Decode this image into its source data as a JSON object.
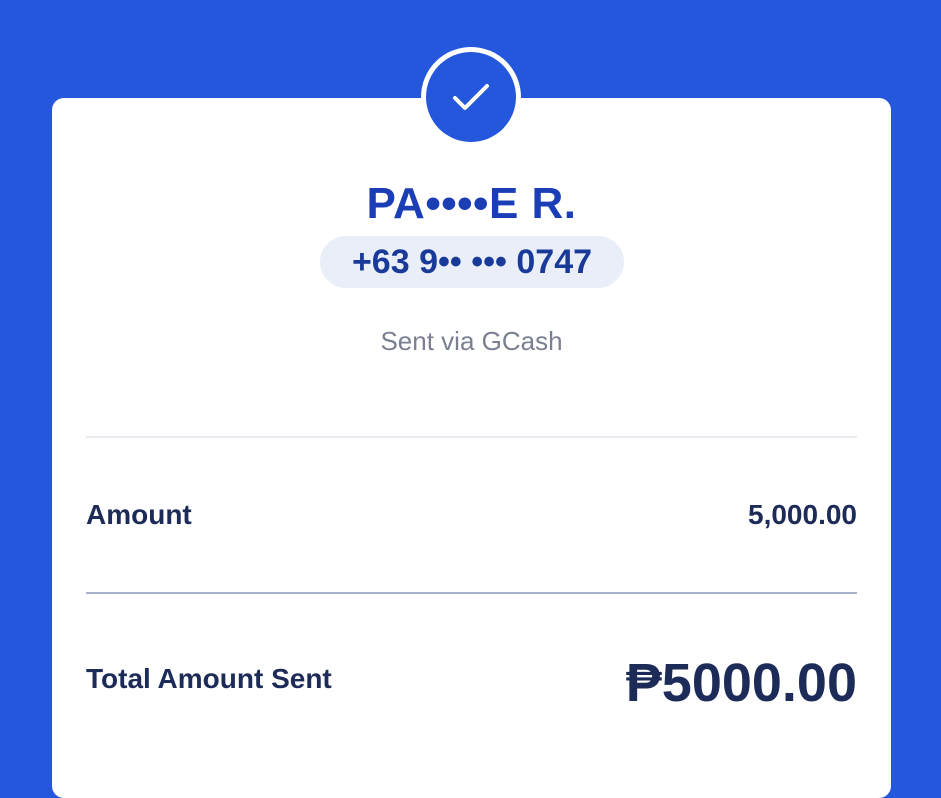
{
  "recipient": {
    "name": "PA••••E R.",
    "phone": "+63 9•• ••• 0747"
  },
  "status": {
    "icon": "check-icon",
    "sent_via": "Sent via GCash"
  },
  "details": {
    "amount_label": "Amount",
    "amount_value": "5,000.00",
    "total_label": "Total Amount Sent",
    "total_value": "₱5000.00"
  },
  "colors": {
    "background": "#2457db",
    "card": "#ffffff",
    "accent": "#1b3db5",
    "text_dark": "#1c2b57",
    "text_muted": "#7a8091",
    "pill": "#e9eef8"
  }
}
